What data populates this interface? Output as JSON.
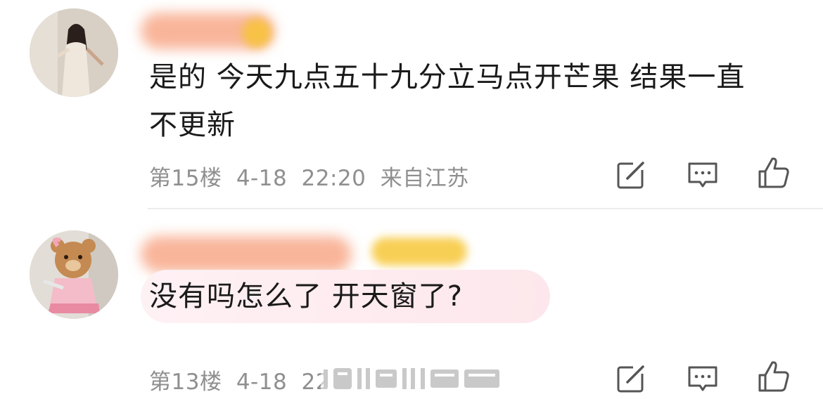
{
  "comments": [
    {
      "text_line1": "是的 今天九点五十九分立马点开芒果 结果一直",
      "text_line2": "不更新",
      "floor": "第15楼",
      "date": "4-18",
      "time": "22:20",
      "location": "来自江苏"
    },
    {
      "text_line1": "没有吗怎么了 开天窗了?",
      "floor": "第13楼",
      "date": "4-18",
      "time": "22"
    }
  ],
  "icons": [
    "edit-icon",
    "reply-icon",
    "like-icon"
  ],
  "colors": {
    "username_blur": "#f9b08a",
    "badge_gold": "#f7c84a",
    "meta_text": "#8f8f8f",
    "icon_stroke": "#555555",
    "bubble_pink": "#fde8ee"
  }
}
